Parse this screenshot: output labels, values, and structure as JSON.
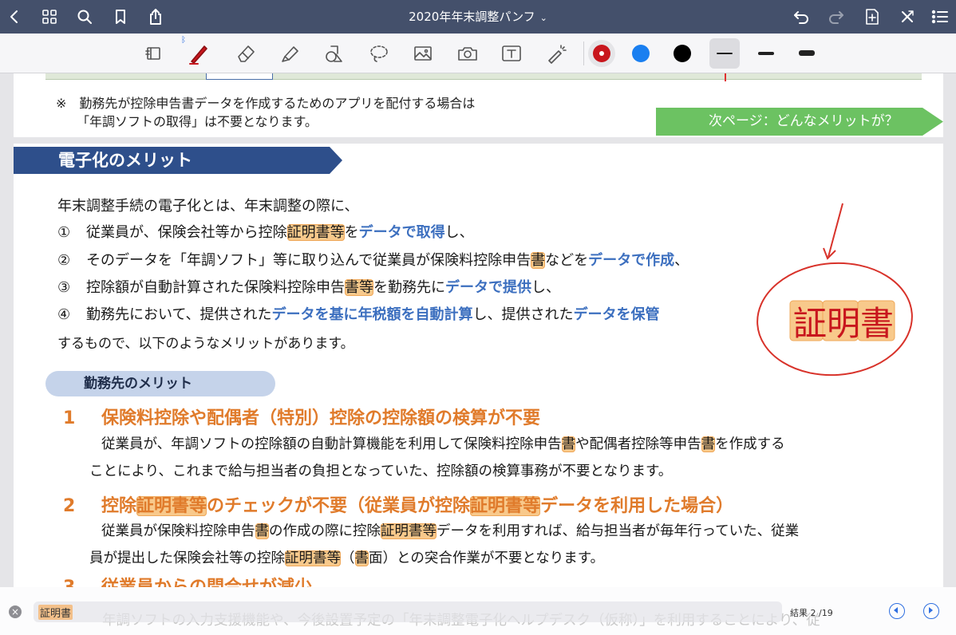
{
  "nav": {
    "title": "2020年年末調整パンフ",
    "title_chevron": "⌄"
  },
  "toolbar": {
    "colors": [
      "#c8161d",
      "#1a7ff0",
      "#000000"
    ],
    "selected_color": "#c8161d"
  },
  "document": {
    "top_note": {
      "line1": "※　勤務先が控除申告書データを作成するためのアプリを配付する場合は",
      "line2": "「年調ソフトの取得」は不要となります。"
    },
    "next_page_label": "次ページ：どんなメリットが？",
    "section_title": "電子化のメリット",
    "intro": "年末調整手続の電子化とは、年末調整の際に、",
    "items": [
      {
        "num": "①",
        "segments": [
          {
            "t": "従業員が、保険会社等から控除"
          },
          {
            "t": "証明書等",
            "style": "hl"
          },
          {
            "t": "を"
          },
          {
            "t": "データで取得",
            "style": "b"
          },
          {
            "t": "し、"
          }
        ]
      },
      {
        "num": "②",
        "segments": [
          {
            "t": "そのデータを「年調ソフト」等に取り込んで従業員が保険料控除申告"
          },
          {
            "t": "書",
            "style": "hl"
          },
          {
            "t": "などを"
          },
          {
            "t": "データで作成",
            "style": "b"
          },
          {
            "t": "、"
          }
        ]
      },
      {
        "num": "③",
        "segments": [
          {
            "t": "控除額が自動計算された保険料控除申告"
          },
          {
            "t": "書等",
            "style": "hl"
          },
          {
            "t": "を勤務先に"
          },
          {
            "t": "データで提供",
            "style": "b"
          },
          {
            "t": "し、"
          }
        ]
      },
      {
        "num": "④",
        "segments": [
          {
            "t": "勤務先において、提供された"
          },
          {
            "t": "データを基に年税額を自動計算",
            "style": "b"
          },
          {
            "t": "し、提供された"
          },
          {
            "t": "データを保管",
            "style": "b"
          }
        ]
      }
    ],
    "closing": "するもので、以下のようなメリットがあります。",
    "employer_pill": "勤務先のメリット",
    "merits": [
      {
        "num": "1",
        "heading": [
          {
            "t": "保険料控除や配偶者（特別）控除の控除額の検算が不要"
          }
        ],
        "body1": [
          {
            "t": "従業員が、年調ソフトの控除額の自動計算機能を利用して保険料控除申告"
          },
          {
            "t": "書",
            "style": "hl"
          },
          {
            "t": "や配偶者控除等申告"
          },
          {
            "t": "書",
            "style": "hl"
          },
          {
            "t": "を作成する"
          }
        ],
        "body2": [
          {
            "t": "ことにより、これまで給与担当者の負担となっていた、控除額の検算事務が不要となります。"
          }
        ]
      },
      {
        "num": "2",
        "heading": [
          {
            "t": "控除"
          },
          {
            "t": "証明書等",
            "style": "hl"
          },
          {
            "t": "のチェックが不要（従業員が控除"
          },
          {
            "t": "証明書等",
            "style": "hl"
          },
          {
            "t": "データを利用した場合）"
          }
        ],
        "body1": [
          {
            "t": "従業員が保険料控除申告"
          },
          {
            "t": "書",
            "style": "hl"
          },
          {
            "t": "の作成の際に控除"
          },
          {
            "t": "証明書等",
            "style": "hl"
          },
          {
            "t": "データを利用すれば、給与担当者が毎年行っていた、従業"
          }
        ],
        "body2": [
          {
            "t": "員が提出した保険会社等の控除"
          },
          {
            "t": "証明書等",
            "style": "hl"
          },
          {
            "t": "（"
          },
          {
            "t": "書",
            "style": "hl"
          },
          {
            "t": "面）との突合作業が不要となります。"
          }
        ]
      },
      {
        "num": "3",
        "heading": [
          {
            "t": "従業員からの問合せが減少"
          }
        ],
        "body1": [
          {
            "t": "年調ソフトの入力支援機能や、今後設置予定の「年末調整電子化ヘルプデスク（仮称）」を利用することにより、従"
          }
        ]
      }
    ],
    "handwritten_note": "証明書"
  },
  "search": {
    "query": "証明書",
    "result": "結果 2 /19"
  }
}
